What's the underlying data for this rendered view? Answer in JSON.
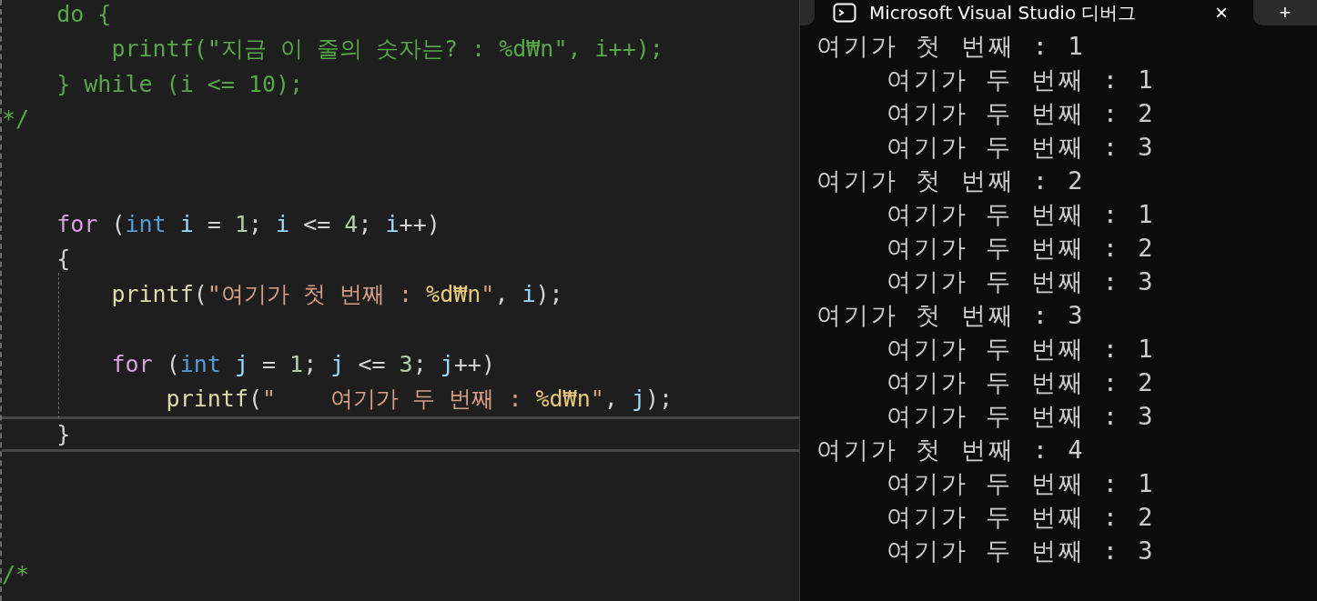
{
  "editor": {
    "lines": [
      {
        "kind": "code",
        "current": false,
        "tokens": [
          {
            "kind": "comment",
            "text": "    do {"
          }
        ]
      },
      {
        "kind": "code",
        "current": false,
        "tokens": [
          {
            "kind": "comment",
            "text": "        printf(\"지금 이 줄의 숫자는? : %d₩n\", i++);"
          }
        ]
      },
      {
        "kind": "code",
        "current": false,
        "tokens": [
          {
            "kind": "comment",
            "text": "    } while (i <= 10);"
          }
        ]
      },
      {
        "kind": "code",
        "current": false,
        "tokens": [
          {
            "kind": "comment",
            "text": "*/"
          }
        ]
      },
      {
        "kind": "blank"
      },
      {
        "kind": "blank"
      },
      {
        "kind": "code",
        "current": false,
        "tokens": [
          {
            "kind": "keyword",
            "text": "    for"
          },
          {
            "kind": "plain",
            "text": " ("
          },
          {
            "kind": "type",
            "text": "int"
          },
          {
            "kind": "ident",
            "text": " i"
          },
          {
            "kind": "plain",
            "text": " = "
          },
          {
            "kind": "number",
            "text": "1"
          },
          {
            "kind": "plain",
            "text": "; "
          },
          {
            "kind": "ident",
            "text": "i"
          },
          {
            "kind": "plain",
            "text": " <= "
          },
          {
            "kind": "number",
            "text": "4"
          },
          {
            "kind": "plain",
            "text": "; "
          },
          {
            "kind": "ident",
            "text": "i"
          },
          {
            "kind": "plain",
            "text": "++)"
          }
        ]
      },
      {
        "kind": "code",
        "current": false,
        "tokens": [
          {
            "kind": "plain",
            "text": "    {"
          }
        ]
      },
      {
        "kind": "code",
        "current": false,
        "tokens": [
          {
            "kind": "function",
            "text": "        printf"
          },
          {
            "kind": "plain",
            "text": "("
          },
          {
            "kind": "string",
            "text": "\"여기가 첫 번째 : "
          },
          {
            "kind": "escape",
            "text": "%d₩n"
          },
          {
            "kind": "string",
            "text": "\""
          },
          {
            "kind": "plain",
            "text": ", "
          },
          {
            "kind": "ident",
            "text": "i"
          },
          {
            "kind": "plain",
            "text": ");"
          }
        ]
      },
      {
        "kind": "blank"
      },
      {
        "kind": "code",
        "current": false,
        "tokens": [
          {
            "kind": "keyword",
            "text": "        for"
          },
          {
            "kind": "plain",
            "text": " ("
          },
          {
            "kind": "type",
            "text": "int"
          },
          {
            "kind": "ident",
            "text": " j"
          },
          {
            "kind": "plain",
            "text": " = "
          },
          {
            "kind": "number",
            "text": "1"
          },
          {
            "kind": "plain",
            "text": "; "
          },
          {
            "kind": "ident",
            "text": "j"
          },
          {
            "kind": "plain",
            "text": " <= "
          },
          {
            "kind": "number",
            "text": "3"
          },
          {
            "kind": "plain",
            "text": "; "
          },
          {
            "kind": "ident",
            "text": "j"
          },
          {
            "kind": "plain",
            "text": "++)"
          }
        ]
      },
      {
        "kind": "code",
        "current": false,
        "tokens": [
          {
            "kind": "function",
            "text": "            printf"
          },
          {
            "kind": "plain",
            "text": "("
          },
          {
            "kind": "string",
            "text": "\"    여기가 두 번째 : "
          },
          {
            "kind": "escape",
            "text": "%d₩n"
          },
          {
            "kind": "string",
            "text": "\""
          },
          {
            "kind": "plain",
            "text": ", "
          },
          {
            "kind": "ident",
            "text": "j"
          },
          {
            "kind": "plain",
            "text": ");"
          }
        ]
      },
      {
        "kind": "code",
        "current": true,
        "tokens": [
          {
            "kind": "plain",
            "text": "    }"
          }
        ]
      },
      {
        "kind": "blank"
      },
      {
        "kind": "blank"
      },
      {
        "kind": "blank"
      },
      {
        "kind": "code",
        "current": false,
        "tokens": [
          {
            "kind": "comment",
            "text": "/*"
          }
        ]
      }
    ]
  },
  "console": {
    "tab": {
      "title": "Microsoft Visual Studio 디버그",
      "close": "×"
    },
    "new_tab": "+",
    "lines": [
      "여기가 첫 번째 : 1",
      "    여기가 두 번째 : 1",
      "    여기가 두 번째 : 2",
      "    여기가 두 번째 : 3",
      "여기가 첫 번째 : 2",
      "    여기가 두 번째 : 1",
      "    여기가 두 번째 : 2",
      "    여기가 두 번째 : 3",
      "여기가 첫 번째 : 3",
      "    여기가 두 번째 : 1",
      "    여기가 두 번째 : 2",
      "    여기가 두 번째 : 3",
      "여기가 첫 번째 : 4",
      "    여기가 두 번째 : 1",
      "    여기가 두 번째 : 2",
      "    여기가 두 번째 : 3"
    ]
  }
}
